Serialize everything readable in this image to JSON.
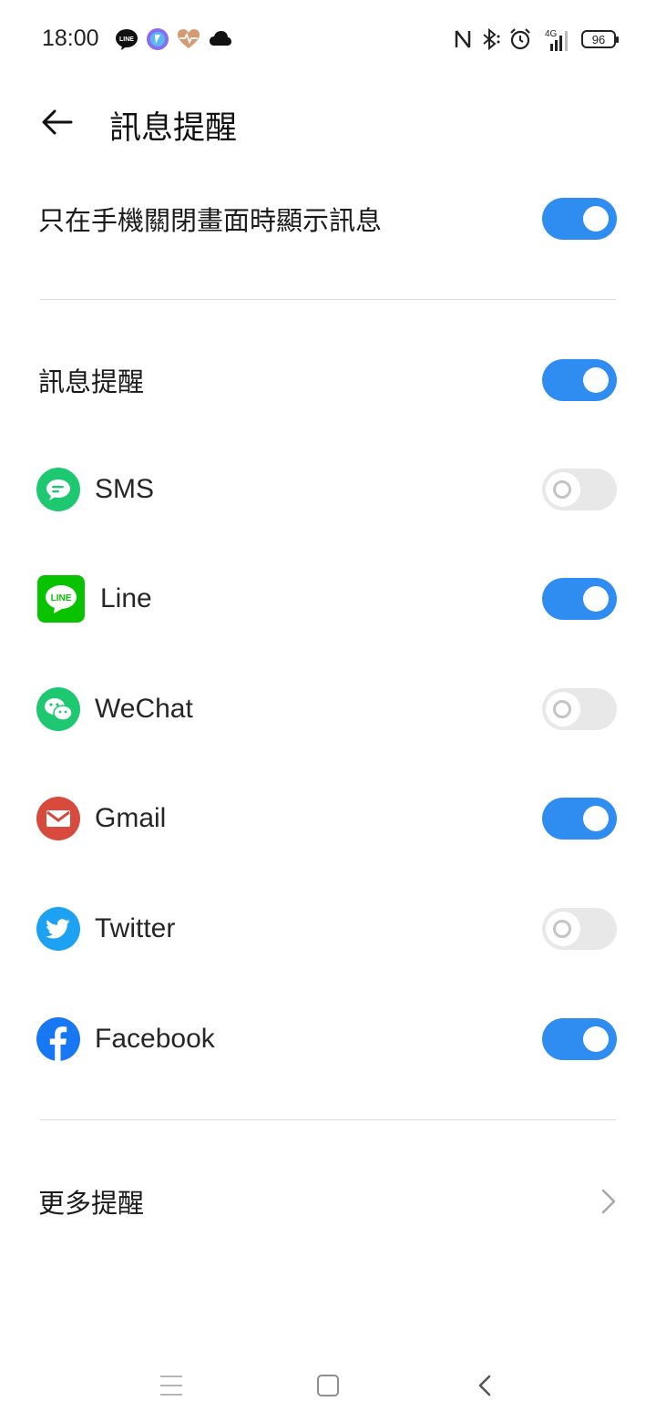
{
  "status_bar": {
    "time": "18:00",
    "left_icons": [
      "line-icon",
      "app-icon",
      "heart-rate-icon",
      "cloud-icon"
    ],
    "right_icons": [
      "nfc-icon",
      "bluetooth-icon",
      "alarm-icon",
      "signal-4g-icon"
    ],
    "network": "4G",
    "battery": "96"
  },
  "header": {
    "title": "訊息提醒"
  },
  "settings": {
    "screen_off_only": {
      "label": "只在手機關閉畫面時顯示訊息",
      "enabled": true
    },
    "message_reminder": {
      "label": "訊息提醒",
      "enabled": true
    },
    "apps": [
      {
        "name": "SMS",
        "icon": "sms-icon",
        "color": "#1dc871",
        "enabled": false
      },
      {
        "name": "Line",
        "icon": "line-icon",
        "color": "#0ac300",
        "enabled": true
      },
      {
        "name": "WeChat",
        "icon": "wechat-icon",
        "color": "#1dc871",
        "enabled": false
      },
      {
        "name": "Gmail",
        "icon": "gmail-icon",
        "color": "#d84a3b",
        "enabled": true
      },
      {
        "name": "Twitter",
        "icon": "twitter-icon",
        "color": "#1da1f2",
        "enabled": false
      },
      {
        "name": "Facebook",
        "icon": "facebook-icon",
        "color": "#1877f2",
        "enabled": true
      }
    ],
    "more_reminders": {
      "label": "更多提醒"
    }
  },
  "colors": {
    "accent": "#2f8cf0",
    "toggle_off": "#e8e8e8",
    "divider": "#dcdcdc"
  }
}
